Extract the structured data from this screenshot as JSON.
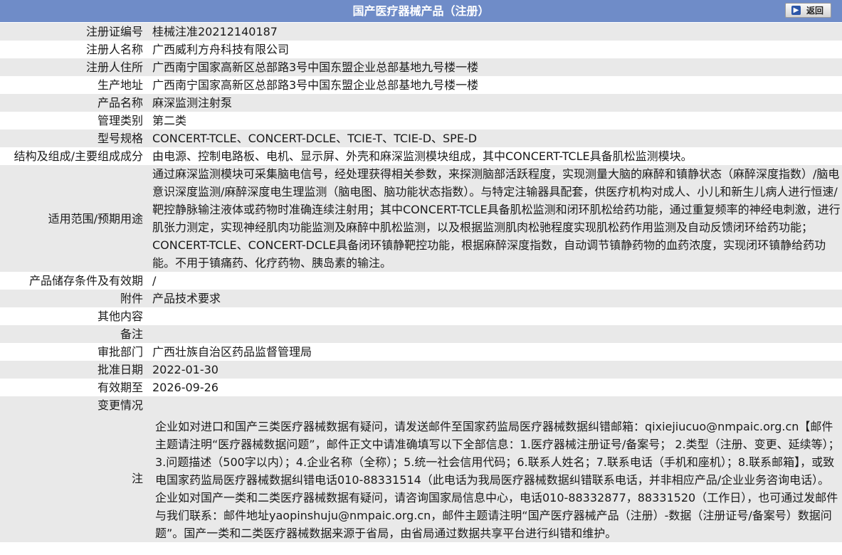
{
  "header": {
    "title": "国产医疗器械产品（注册）",
    "back_label": "返回"
  },
  "fields": [
    {
      "label": "注册证编号",
      "value": "桂械注准20212140187"
    },
    {
      "label": "注册人名称",
      "value": "广西威利方舟科技有限公司"
    },
    {
      "label": "注册人住所",
      "value": "广西南宁国家高新区总部路3号中国东盟企业总部基地九号楼一楼"
    },
    {
      "label": "生产地址",
      "value": "广西南宁国家高新区总部路3号中国东盟企业总部基地九号楼一楼"
    },
    {
      "label": "产品名称",
      "value": "麻深监测注射泵"
    },
    {
      "label": "管理类别",
      "value": "第二类"
    },
    {
      "label": "型号规格",
      "value": "CONCERT-TCLE、CONCERT-DCLE、TCIE-T、TCIE-D、SPE-D"
    },
    {
      "label": "结构及组成/主要组成成分",
      "value": "由电源、控制电路板、电机、显示屏、外壳和麻深监测模块组成，其中CONCERT-TCLE具备肌松监测模块。"
    },
    {
      "label": "适用范围/预期用途",
      "value": "通过麻深监测模块可采集脑电信号，经处理获得相关参数，来探测脑部活跃程度，实现测量大脑的麻醉和镇静状态（麻醉深度指数）/脑电意识深度监测/麻醉深度电生理监测（脑电图、脑功能状态指数）。与特定注输器具配套，供医疗机构对成人、小儿和新生儿病人进行恒速/靶控静脉输注液体或药物时准确连续注射用；其中CONCERT-TCLE具备肌松监测和闭环肌松给药功能，通过重复频率的神经电刺激，进行肌张力测定，实现神经肌肉功能监测及麻醉中肌松监测，以及根据监测肌肉松驰程度实现肌松药作用监测及自动反馈闭环给药功能；CONCERT-TCLE、CONCERT-DCLE具备闭环镇静靶控功能，根据麻醉深度指数，自动调节镇静药物的血药浓度，实现闭环镇静给药功能。不用于镇痛药、化疗药物、胰岛素的输注。"
    },
    {
      "label": "产品储存条件及有效期",
      "value": "/"
    },
    {
      "label": "附件",
      "value": "产品技术要求"
    },
    {
      "label": "其他内容",
      "value": ""
    },
    {
      "label": "备注",
      "value": ""
    },
    {
      "label": "审批部门",
      "value": "广西壮族自治区药品监督管理局"
    },
    {
      "label": "批准日期",
      "value": "2022-01-30"
    },
    {
      "label": "有效期至",
      "value": "2026-09-26"
    },
    {
      "label": "变更情况",
      "value": ""
    }
  ],
  "note": {
    "label": "注",
    "text": "企业如对进口和国产三类医疗器械数据有疑问，请发送邮件至国家药监局医疗器械数据纠错邮箱：qixiejiucuo@nmpaic.org.cn【邮件主题请注明“医疗器械数据问题”，邮件正文中请准确填写以下全部信息：1.医疗器械注册证号/备案号； 2.类型（注册、变更、延续等）；3.问题描述（500字以内）；4.企业名称（全称）；5.统一社会信用代码；6.联系人姓名；7.联系电话（手机和座机）；8.联系邮箱】，或致电国家药监局医疗器械数据纠错电话010-88331514（此电话为我局医疗器械数据纠错联系电话，并非相应产品/企业业务咨询电话）。企业如对国产一类和二类医疗器械数据有疑问，请咨询国家局信息中心，电话010-88332877，88331520（工作日），也可通过发邮件与我们联系：邮件地址yaopinshuju@nmpaic.org.cn，邮件主题请注明“国产医疗器械产品（注册）-数据（注册证号/备案号）数据问题”。国产一类和二类医疗器械数据来源于省局，由省局通过数据共享平台进行纠错和维护。"
  }
}
